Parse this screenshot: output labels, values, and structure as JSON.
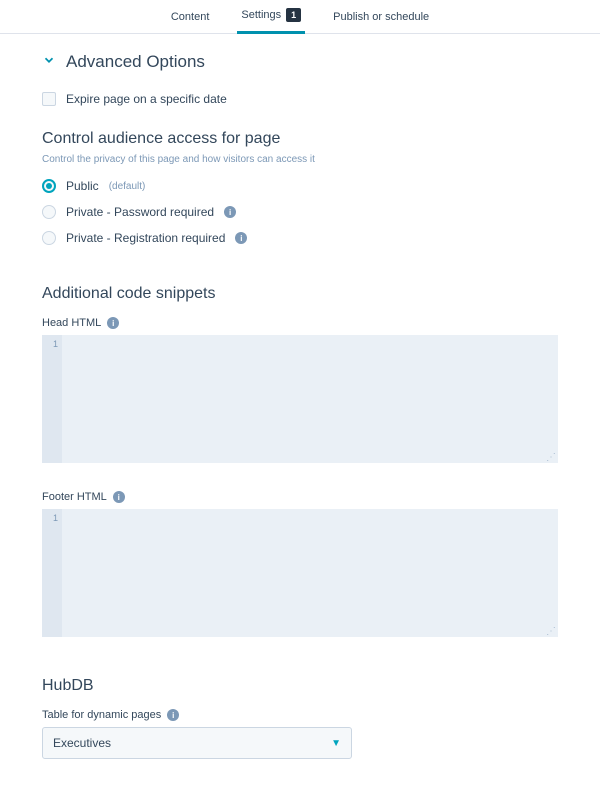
{
  "tabs": {
    "content": "Content",
    "settings": "Settings",
    "settings_badge": "1",
    "publish": "Publish or schedule"
  },
  "advanced": {
    "title": "Advanced Options"
  },
  "expire": {
    "label": "Expire page on a specific date"
  },
  "audience": {
    "title": "Control audience access for page",
    "subtitle": "Control the privacy of this page and how visitors can access it",
    "public": "Public",
    "default": "(default)",
    "private_password": "Private - Password required",
    "private_registration": "Private - Registration required"
  },
  "snippets": {
    "title": "Additional code snippets",
    "head_label": "Head HTML",
    "footer_label": "Footer HTML",
    "line_num": "1"
  },
  "hubdb": {
    "title": "HubDB",
    "table_label": "Table for dynamic pages",
    "selected": "Executives"
  }
}
